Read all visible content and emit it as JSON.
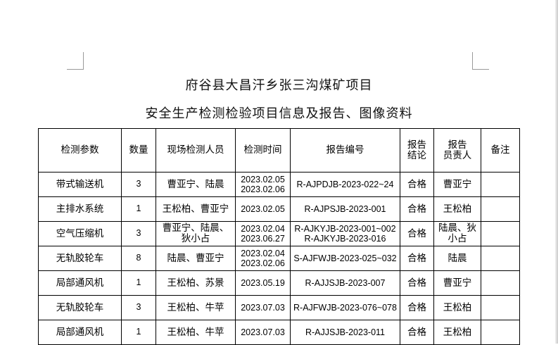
{
  "title_line1": "府谷县大昌汗乡张三沟煤矿项目",
  "title_line2": "安全生产检测检验项目信息及报告、图像资料",
  "headers": {
    "param": "检测参数",
    "qty": "数量",
    "staff": "现场检测人员",
    "time": "检测时间",
    "report_no": "报告编号",
    "conclusion_1": "报告",
    "conclusion_2": "结论",
    "resp_1": "报告",
    "resp_2": "员责人",
    "remark": "备注"
  },
  "rows": [
    {
      "param": "带式输送机",
      "qty": "3",
      "staff": [
        "曹亚宁、陆晨"
      ],
      "dates": [
        "2023.02.05",
        "2023.02.06"
      ],
      "reports": [
        "R-AJPDJB-2023-022~24"
      ],
      "result": "合格",
      "resp": [
        "曹亚宁"
      ],
      "remark": ""
    },
    {
      "param": "主排水系统",
      "qty": "1",
      "staff": [
        "王松柏、曹亚宁"
      ],
      "dates": [
        "2023.02.05"
      ],
      "reports": [
        "R-AJPSJB-2023-001"
      ],
      "result": "合格",
      "resp": [
        "王松柏"
      ],
      "remark": ""
    },
    {
      "param": "空气压缩机",
      "qty": "3",
      "staff": [
        "曹亚宁、陆晨、",
        "狄小占"
      ],
      "dates": [
        "2023.02.04",
        "2023.06.27"
      ],
      "reports": [
        "R-AJKYJB-2023-001~002",
        "R-AJKYJB-2023-016"
      ],
      "result": "合格",
      "resp": [
        "陆晨、狄",
        "小占"
      ],
      "remark": ""
    },
    {
      "param": "无轨胶轮车",
      "qty": "8",
      "staff": [
        "陆晨、曹亚宁"
      ],
      "dates": [
        "2023.02.04",
        "2023.02.06"
      ],
      "reports": [
        "S-AJFWJB-2023-025~032"
      ],
      "result": "合格",
      "resp": [
        "陆晨"
      ],
      "remark": ""
    },
    {
      "param": "局部通风机",
      "qty": "1",
      "staff": [
        "王松柏、苏景"
      ],
      "dates": [
        "2023.05.19"
      ],
      "reports": [
        "R-AJJSJB-2023-007"
      ],
      "result": "合格",
      "resp": [
        "曹亚宁"
      ],
      "remark": ""
    },
    {
      "param": "无轨胶轮车",
      "qty": "3",
      "staff": [
        "王松柏、牛苹"
      ],
      "dates": [
        "2023.07.03"
      ],
      "reports": [
        "R-AJFWJB-2023-076~078"
      ],
      "result": "合格",
      "resp": [
        "王松柏"
      ],
      "remark": ""
    },
    {
      "param": "局部通风机",
      "qty": "1",
      "staff": [
        "王松柏、牛苹"
      ],
      "dates": [
        "2023.07.03"
      ],
      "reports": [
        "R-AJJSJB-2023-011"
      ],
      "result": "合格",
      "resp": [
        "王松柏"
      ],
      "remark": ""
    }
  ]
}
